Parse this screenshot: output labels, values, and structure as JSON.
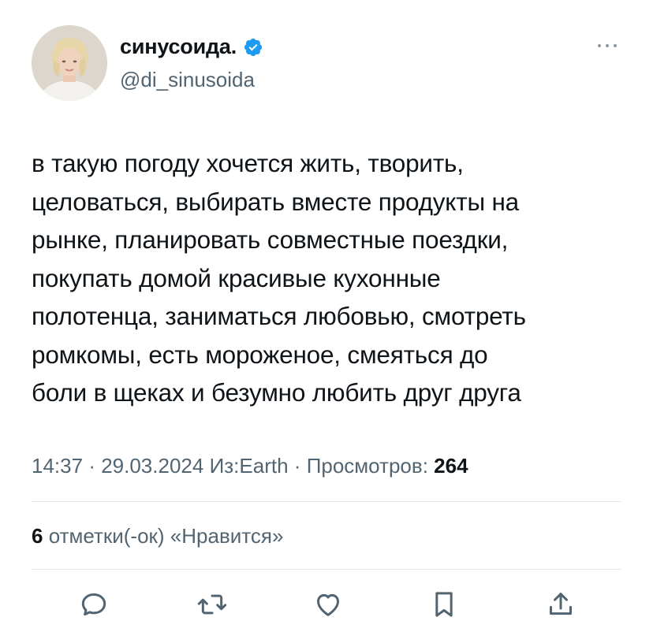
{
  "author": {
    "name": "синусоида.",
    "handle": "@di_sinusoida",
    "verified_color": "#1d9bf0"
  },
  "tweet": {
    "lines": [
      "в такую погоду хочется жить, творить,",
      "целоваться, выбирать вместе продукты на",
      "рынке, планировать совместные поездки,",
      "покупать домой красивые кухонные",
      "полотенца, заниматься любовью, смотреть",
      "ромкомы, есть мороженое, смеяться до",
      "боли в щеках и безумно любить друг друга"
    ]
  },
  "meta": {
    "time": "14:37",
    "date": "29.03.2024",
    "source": "Из:Earth",
    "views_label": "Просмотров:",
    "views_count": "264",
    "separator": "·"
  },
  "likes": {
    "count": "6",
    "label": "отметки(-ок) «Нравится»"
  },
  "actions": {
    "reply_icon": "reply-icon",
    "retweet_icon": "retweet-icon",
    "like_icon": "heart-icon",
    "bookmark_icon": "bookmark-icon",
    "share_icon": "share-icon"
  },
  "colors": {
    "text": "#0f1419",
    "secondary": "#536471",
    "divider": "#e3e7ea"
  }
}
